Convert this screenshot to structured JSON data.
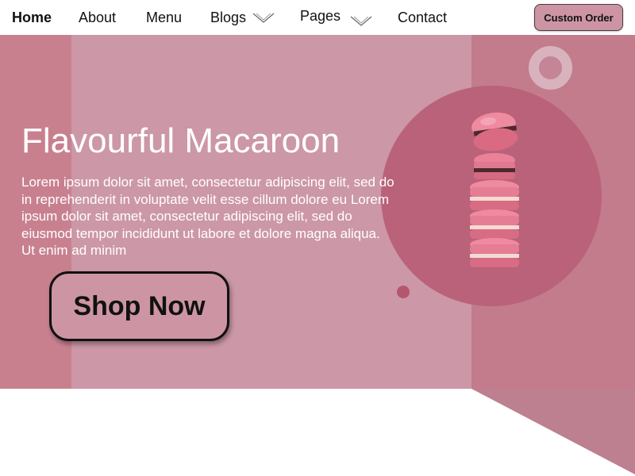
{
  "nav": {
    "items": [
      {
        "label": "Home"
      },
      {
        "label": "About"
      },
      {
        "label": "Menu"
      },
      {
        "label": "Blogs"
      },
      {
        "label": "Pages"
      },
      {
        "label": "Contact"
      }
    ],
    "custom_order_label": "Custom Order"
  },
  "hero": {
    "title": "Flavourful Macaroon",
    "description": "Lorem ipsum dolor sit amet, consectetur adipiscing elit, sed do in reprehenderit in voluptate velit esse cillum dolore eu  Lorem ipsum dolor sit amet, consectetur adipiscing elit, sed do eiusmod tempor incididunt ut labore et dolore magna aliqua. Ut enim ad minim",
    "shop_button_label": "Shop Now",
    "image_icon": "macaron-stack-icon"
  },
  "colors": {
    "panel_left": "#c8808f",
    "panel_mid": "#cc97a6",
    "panel_right": "#c27c8c",
    "circle": "#b9627a",
    "dot": "#b5566f",
    "floor": "#bc8090",
    "button_bg": "#cd95a4",
    "macaron": "#e8788f",
    "macaron_dark": "#c95b73",
    "filling_cream": "#f3dbd2",
    "filling_choc": "#4a2a2e"
  }
}
